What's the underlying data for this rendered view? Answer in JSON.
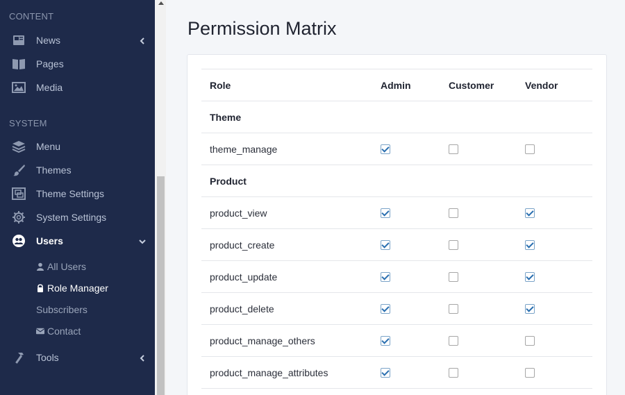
{
  "sidebar": {
    "sections": {
      "content": "CONTENT",
      "system": "SYSTEM"
    },
    "items": [
      {
        "label": "News",
        "icon": "newspaper-icon",
        "chevron": "chevron-left-icon"
      },
      {
        "label": "Pages",
        "icon": "book-icon"
      },
      {
        "label": "Media",
        "icon": "image-icon"
      },
      {
        "label": "Menu",
        "icon": "layers-icon"
      },
      {
        "label": "Themes",
        "icon": "brush-icon"
      },
      {
        "label": "Theme Settings",
        "icon": "theme-settings-icon"
      },
      {
        "label": "System Settings",
        "icon": "gear-icon"
      },
      {
        "label": "Users",
        "icon": "users-icon",
        "chevron": "chevron-down-icon"
      },
      {
        "label": "Tools",
        "icon": "hammer-icon",
        "chevron": "chevron-left-icon"
      }
    ],
    "users_sub": [
      {
        "label": "All Users",
        "icon": "user-icon"
      },
      {
        "label": "Role Manager",
        "icon": "lock-icon"
      },
      {
        "label": "Subscribers"
      },
      {
        "label": "Contact",
        "icon": "envelope-icon"
      }
    ]
  },
  "main": {
    "title": "Permission Matrix",
    "columns": [
      "Role",
      "Admin",
      "Customer",
      "Vendor"
    ],
    "rows": [
      {
        "type": "group",
        "label": "Theme"
      },
      {
        "type": "perm",
        "label": "theme_manage",
        "admin": true,
        "customer": false,
        "vendor": false
      },
      {
        "type": "group",
        "label": "Product"
      },
      {
        "type": "perm",
        "label": "product_view",
        "admin": true,
        "customer": false,
        "vendor": true
      },
      {
        "type": "perm",
        "label": "product_create",
        "admin": true,
        "customer": false,
        "vendor": true
      },
      {
        "type": "perm",
        "label": "product_update",
        "admin": true,
        "customer": false,
        "vendor": true
      },
      {
        "type": "perm",
        "label": "product_delete",
        "admin": true,
        "customer": false,
        "vendor": true
      },
      {
        "type": "perm",
        "label": "product_manage_others",
        "admin": true,
        "customer": false,
        "vendor": false
      },
      {
        "type": "perm",
        "label": "product_manage_attributes",
        "admin": true,
        "customer": false,
        "vendor": false
      }
    ]
  },
  "colors": {
    "sidebar_bg": "#1e2a4a",
    "checkbox_check": "#2a6fb0"
  }
}
